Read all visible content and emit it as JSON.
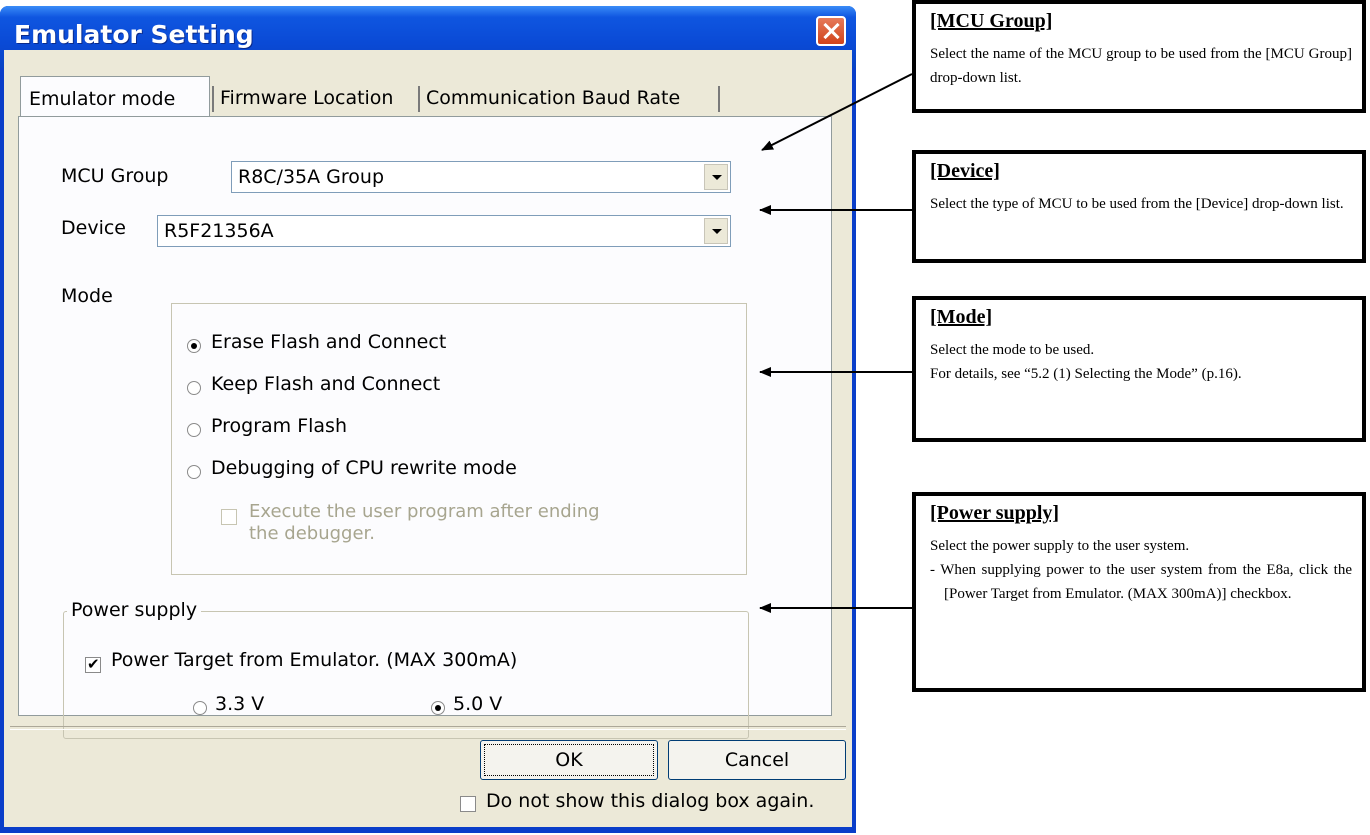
{
  "window": {
    "title": "Emulator Setting",
    "close_label": "✕"
  },
  "tabs": [
    {
      "label": "Emulator mode",
      "active": true
    },
    {
      "label": "Firmware Location",
      "active": false
    },
    {
      "label": "Communication Baud Rate",
      "active": false
    }
  ],
  "mcu_group": {
    "label": "MCU Group",
    "value": "R8C/35A Group"
  },
  "device": {
    "label": "Device",
    "value": "R5F21356A"
  },
  "mode": {
    "label": "Mode",
    "options": [
      {
        "label": "Erase Flash and Connect",
        "selected": true
      },
      {
        "label": "Keep Flash and Connect",
        "selected": false
      },
      {
        "label": "Program Flash",
        "selected": false
      },
      {
        "label": "Debugging of CPU rewrite mode",
        "selected": false
      }
    ],
    "execute_checkbox": {
      "line1": "Execute the user program after ending",
      "line2": "the debugger.",
      "checked": false,
      "enabled": false
    }
  },
  "power_supply": {
    "legend": "Power supply",
    "checkbox_label": "Power Target from Emulator. (MAX 300mA)",
    "checked": true,
    "voltages": [
      {
        "label": "3.3 V",
        "selected": false
      },
      {
        "label": "5.0 V",
        "selected": true
      }
    ]
  },
  "buttons": {
    "ok": "OK",
    "cancel": "Cancel"
  },
  "dont_show": {
    "label": "Do not show this dialog box again.",
    "checked": false
  },
  "callouts": {
    "mcu_group": {
      "title": "[MCU Group]",
      "text": "Select the name of the MCU group to be used from the [MCU Group] drop-down list."
    },
    "device": {
      "title": "[Device]",
      "text": "Select the type of MCU to be used from the [Device] drop-down list."
    },
    "mode": {
      "title": "[Mode]",
      "line1": "Select the mode to be used.",
      "line2": "For details, see “5.2 (1) Selecting the Mode” (p.16)."
    },
    "power": {
      "title": "[Power supply]",
      "line1": "Select the power supply to the user system.",
      "line2": "- When supplying power to the user system from the E8a, click the [Power Target from Emulator. (MAX 300mA)] checkbox."
    }
  }
}
